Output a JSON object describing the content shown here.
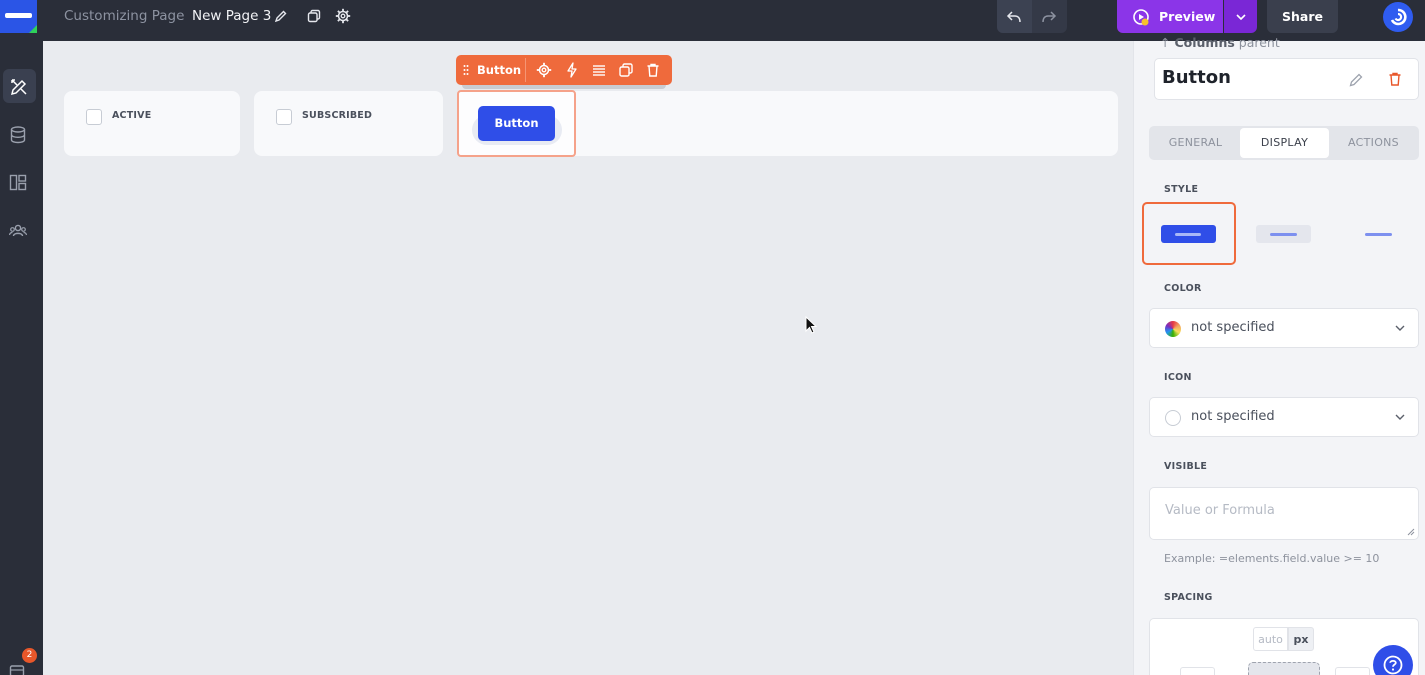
{
  "topbar": {
    "breadcrumb": "Customizing Page",
    "page_name": "New Page 3",
    "preview_label": "Preview",
    "share_label": "Share"
  },
  "sidebar": {
    "notification_count": "2"
  },
  "canvas": {
    "cards": [
      {
        "label": "ACTIVE"
      },
      {
        "label": "SUBSCRIBED"
      }
    ],
    "selected_button_label": "Button",
    "element_toolbar_name": "Button"
  },
  "panel": {
    "parent_arrow": "↑",
    "parent_name": "Columns",
    "parent_suffix": "parent",
    "element_title": "Button",
    "tabs": [
      {
        "label": "GENERAL"
      },
      {
        "label": "DISPLAY"
      },
      {
        "label": "ACTIONS"
      }
    ],
    "active_tab": "DISPLAY",
    "style_label": "STYLE",
    "color_label": "COLOR",
    "color_value": "not specified",
    "icon_label": "ICON",
    "icon_value": "not specified",
    "visible_label": "VISIBLE",
    "visible_placeholder": "Value or Formula",
    "visible_hint": "Example: =elements.field.value >= 10",
    "spacing_label": "SPACING",
    "spacing_units": [
      "auto",
      "px"
    ]
  },
  "colors": {
    "accent_orange": "#ef6a3c",
    "primary_blue": "#2f4ee8",
    "preview_purple": "#8b35e8",
    "topbar_bg": "#2a2e39"
  }
}
